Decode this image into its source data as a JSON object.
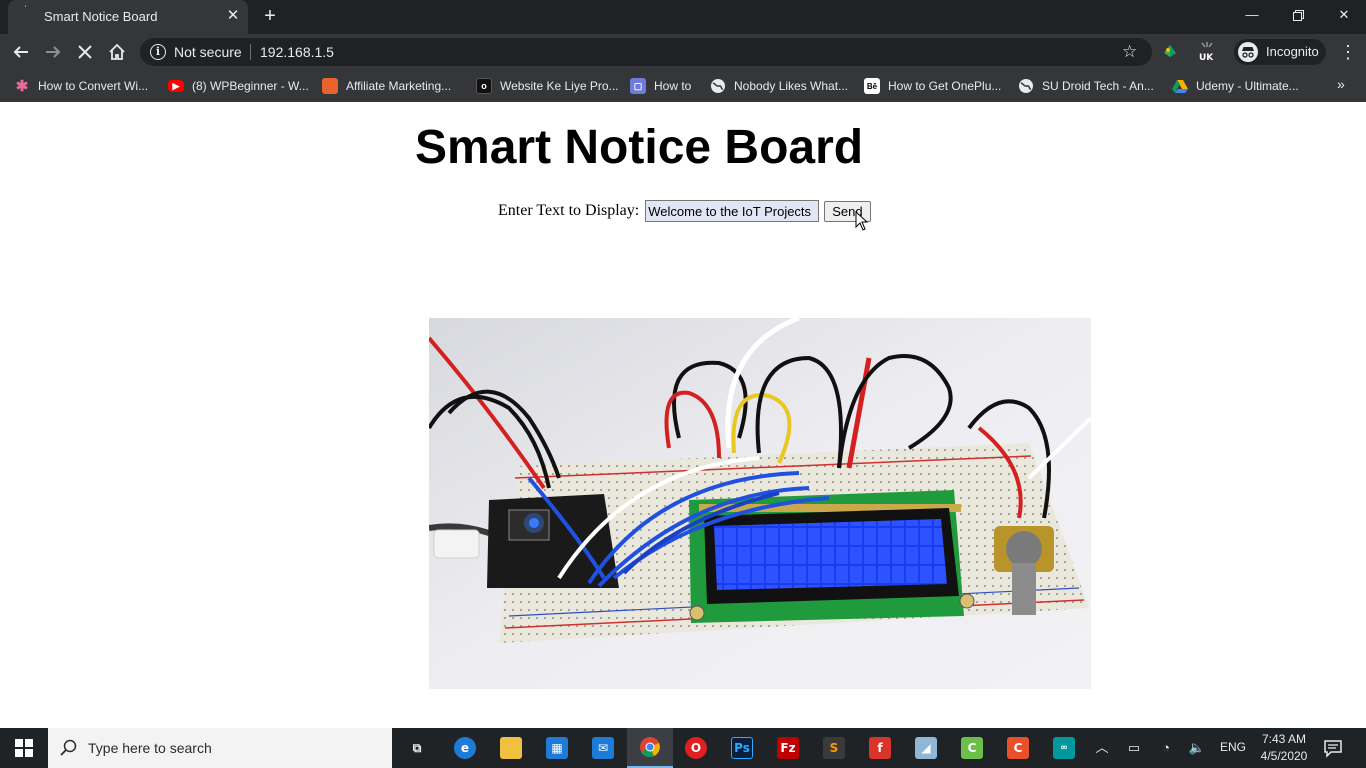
{
  "browser": {
    "tab": {
      "title": "Smart Notice Board",
      "favicon": "loading-dot"
    },
    "window_controls": [
      "minimize",
      "restore",
      "close"
    ],
    "security": "Not secure",
    "url": "192.168.1.5",
    "profile": "Incognito",
    "bookmarks": [
      {
        "label": "How to Convert Wi...",
        "icon": "star-icon",
        "color": "#e86c9a"
      },
      {
        "label": "(8) WPBeginner - W...",
        "icon": "youtube-icon",
        "color": "#ff0000"
      },
      {
        "label": "Affiliate Marketing...",
        "icon": "site-icon",
        "color": "#e8622c"
      },
      {
        "label": "Website Ke Liye Pro...",
        "icon": "site-icon",
        "color": "#111111"
      },
      {
        "label": "How to",
        "icon": "twitch-icon",
        "color": "#6f7bd8"
      },
      {
        "label": "Nobody Likes What...",
        "icon": "globe-icon",
        "color": "#e8eaed"
      },
      {
        "label": "How to Get OnePlu...",
        "icon": "behance-icon",
        "color": "#111111"
      },
      {
        "label": "SU Droid Tech - An...",
        "icon": "globe-icon",
        "color": "#e8eaed"
      },
      {
        "label": "Udemy - Ultimate...",
        "icon": "drive-icon",
        "color": "#f4b400"
      }
    ]
  },
  "page": {
    "title": "Smart Notice Board",
    "form": {
      "label": "Enter Text to Display:",
      "input_value": "Welcome to the IoT Projects",
      "button_label": "Send"
    },
    "image": "breadboard with NodeMCU board, 16x2 blue LCD display, potentiometer and jumper wires"
  },
  "taskbar": {
    "search_placeholder": "Type here to search",
    "apps": [
      "task-view-icon",
      "edge-icon",
      "file-explorer-icon",
      "store-icon",
      "mail-icon",
      "chrome-icon",
      "opera-icon",
      "photoshop-icon",
      "filezilla-icon",
      "sublime-icon",
      "foxit-icon",
      "paint-icon",
      "camtasia-icon",
      "camtasia-red-icon",
      "arduino-icon"
    ],
    "language": "ENG",
    "time": "7:43 AM",
    "date": "4/5/2020"
  },
  "colors": {
    "chrome_dark": "#202124",
    "chrome_toolbar": "#35363a",
    "taskbar": "#202326",
    "accent": "#76b9ed"
  }
}
